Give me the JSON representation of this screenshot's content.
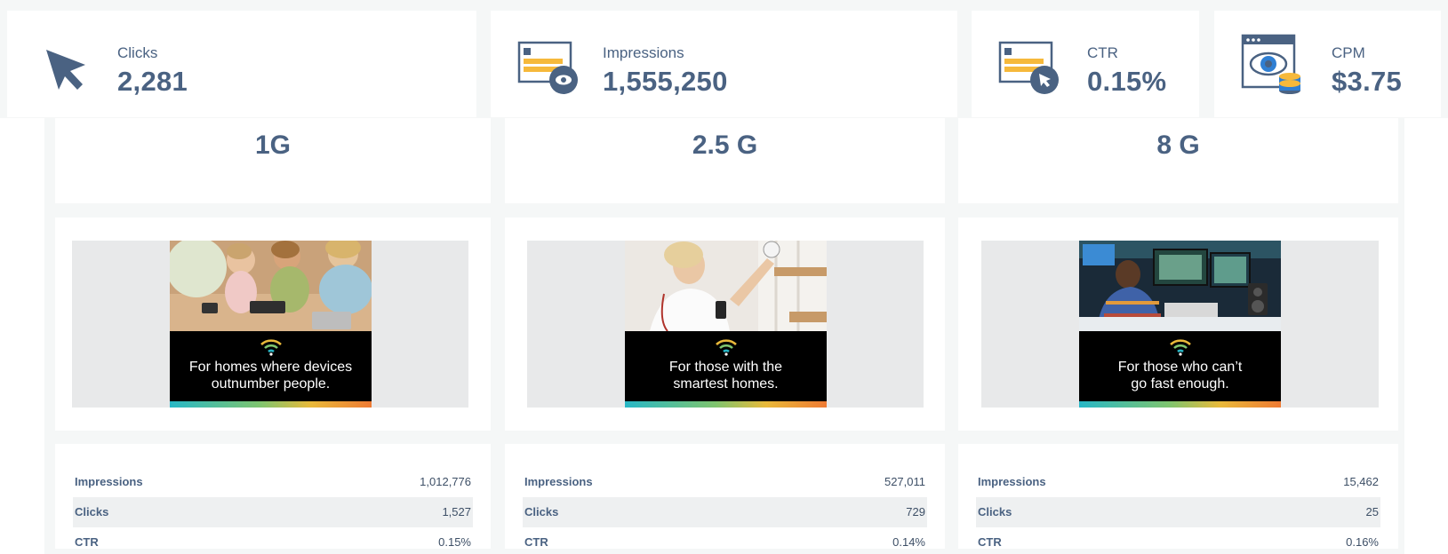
{
  "kpis": [
    {
      "label": "Clicks",
      "value": "2,281",
      "icon": "cursor-icon"
    },
    {
      "label": "Impressions",
      "value": "1,555,250",
      "icon": "browser-eye-icon"
    },
    {
      "label": "CTR",
      "value": "0.15%",
      "icon": "browser-click-icon"
    },
    {
      "label": "CPM",
      "value": "$3.75",
      "icon": "eye-coins-icon"
    }
  ],
  "columns": [
    {
      "title": "1G",
      "ad_text_line1": "For homes where devices",
      "ad_text_line2": "outnumber people.",
      "stats": [
        {
          "label": "Impressions",
          "value": "1,012,776"
        },
        {
          "label": "Clicks",
          "value": "1,527"
        },
        {
          "label": "CTR",
          "value": "0.15%"
        }
      ]
    },
    {
      "title": "2.5 G",
      "ad_text_line1": "For those with the",
      "ad_text_line2": "smartest homes.",
      "stats": [
        {
          "label": "Impressions",
          "value": "527,011"
        },
        {
          "label": "Clicks",
          "value": "729"
        },
        {
          "label": "CTR",
          "value": "0.14%"
        }
      ]
    },
    {
      "title": "8 G",
      "ad_text_line1": "For those who can’t",
      "ad_text_line2": "go fast enough.",
      "stats": [
        {
          "label": "Impressions",
          "value": "15,462"
        },
        {
          "label": "Clicks",
          "value": "25"
        },
        {
          "label": "CTR",
          "value": "0.16%"
        }
      ]
    }
  ],
  "colors": {
    "text": "#4a6282",
    "icon_dark": "#4a6282",
    "icon_yellow": "#f6b93b",
    "icon_blue": "#2f7fd3",
    "panel_bg": "#f5f7f7",
    "ad_frame": "#e8e9ea"
  }
}
